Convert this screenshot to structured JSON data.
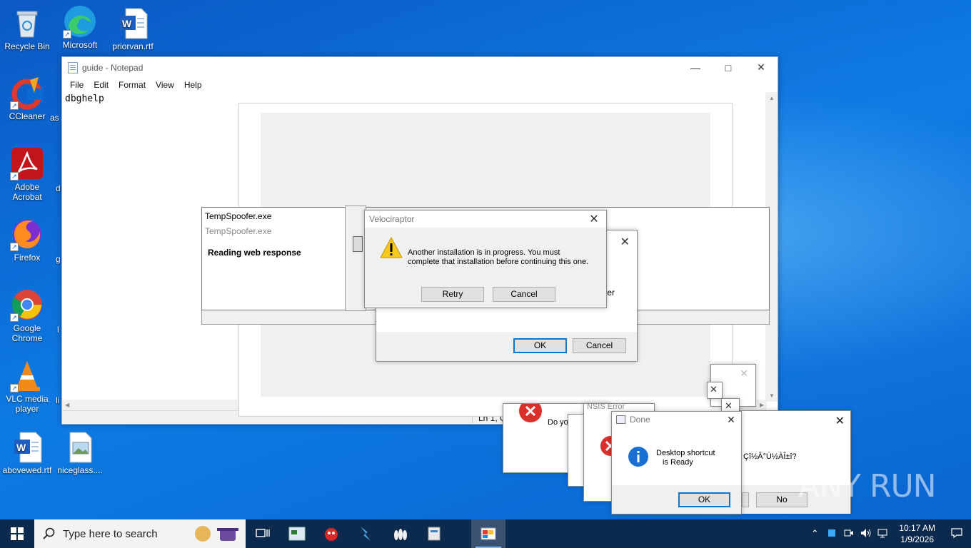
{
  "desktop": {
    "icons": [
      {
        "label": "Recycle Bin"
      },
      {
        "label": "Microsoft Edge"
      },
      {
        "label": "priorvan.rtf"
      },
      {
        "label": "CCleaner"
      },
      {
        "label": "Adobe Acrobat"
      },
      {
        "label": "Firefox"
      },
      {
        "label": "Google Chrome"
      },
      {
        "label": "VLC media player"
      },
      {
        "label": "abovewed.rtf"
      },
      {
        "label": "niceglass...."
      }
    ],
    "partial_labels": [
      "as",
      "d",
      "g",
      "l",
      "li"
    ]
  },
  "notepad": {
    "title": "guide - Notepad",
    "menu": [
      "File",
      "Edit",
      "Format",
      "View",
      "Help"
    ],
    "content": "dbghelp",
    "status_position": "Ln 1, C"
  },
  "tempspoofer": {
    "title": "TempSpoofer.exe",
    "subtitle": "TempSpoofer.exe",
    "status": "Reading web response"
  },
  "velociraptor": {
    "title": "Velociraptor",
    "message": "Another installation is in progress. You must complete that installation before continuing this one.",
    "retry_label": "Retry",
    "cancel_label": "Cancel"
  },
  "setup_dialog": {
    "partial_text": "ter",
    "ok_label": "OK",
    "cancel_label": "Cancel"
  },
  "error_stack": {
    "partial_text_1": "Do yo",
    "partial_title_2": "NSIS Error",
    "garbled_text": "Çî½Â°Ú½ÀÎ±î?",
    "no_label": "No"
  },
  "done_dialog": {
    "title": "Done",
    "message_line1": "Desktop shortcut",
    "message_line2": "is Ready",
    "ok_label": "OK"
  },
  "taskbar": {
    "search_placeholder": "Type here to search",
    "time": "10:17 AM",
    "date": "1/9/2026"
  },
  "watermark": "ANY RUN"
}
